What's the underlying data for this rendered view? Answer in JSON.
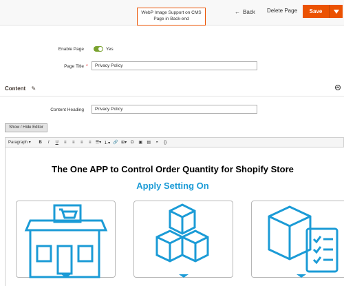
{
  "header": {
    "callout": "WebP Image Support on CMS Page in Back-end",
    "back_label": "Back",
    "delete_label": "Delete Page",
    "save_label": "Save"
  },
  "form": {
    "enable_page_label": "Enable Page",
    "enable_value": "Yes",
    "page_title_label": "Page Title",
    "page_title_value": "Privacy Policy",
    "content_section_title": "Content",
    "content_heading_label": "Content Heading",
    "content_heading_value": "Privacy Policy",
    "show_hide_editor": "Show / Hide Editor"
  },
  "editor": {
    "paragraph_select": "Paragraph",
    "headline": "The One APP to Control Order Quantity for Shopify Store",
    "subhead": "Apply Setting On"
  },
  "colors": {
    "accent": "#eb5202",
    "toggle_on": "#79a22e",
    "illustration_blue": "#1b9bd6"
  }
}
